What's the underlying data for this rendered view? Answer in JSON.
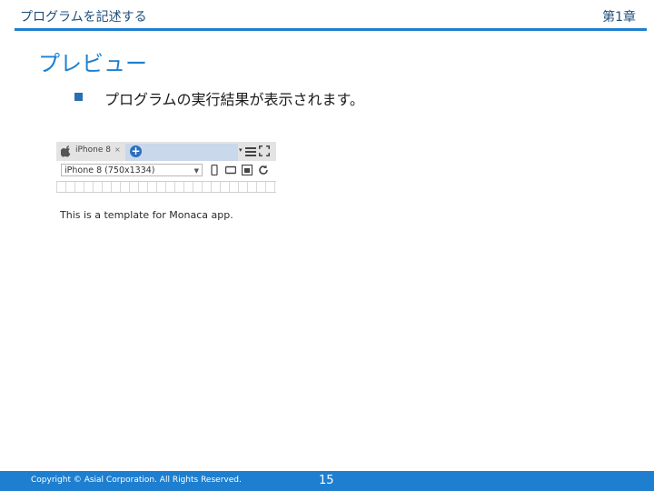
{
  "header": {
    "section_title": "プログラムを記述する",
    "chapter": "第1章"
  },
  "slide": {
    "title": "プレビュー",
    "bullet": "プログラムの実行結果が表示されます。"
  },
  "preview": {
    "device_tab": "iPhone 8",
    "close_mark": "×",
    "add_symbol": "+",
    "caret": "▾",
    "device_select": "iPhone 8 (750x1334)",
    "select_caret": "▼",
    "content_text": "This is a template for Monaca app.",
    "icons": [
      "apple-icon",
      "add-icon",
      "menu-icon",
      "expand-icon",
      "phone-portrait-icon",
      "tablet-icon",
      "screenshot-icon",
      "refresh-icon"
    ]
  },
  "footer": {
    "copyright": "Copyright © Asial Corporation. All Rights Reserved.",
    "page_number": "15"
  },
  "colors": {
    "accent": "#1e7fd0",
    "bullet": "#2a6fb0",
    "footer_bg": "#1e7fd0"
  }
}
